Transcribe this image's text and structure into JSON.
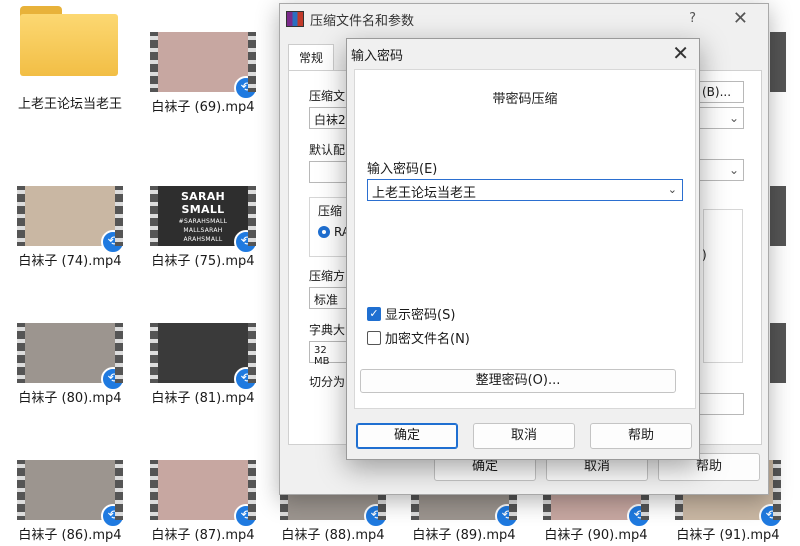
{
  "desktop": {
    "folder": {
      "name": "上老王论坛当老王"
    },
    "files": [
      {
        "name": "白袜子 (69).mp4"
      },
      {
        "name": "白袜子 (74).mp4"
      },
      {
        "name": "白袜子 (75).mp4",
        "thumb_title": "SARAH SMALL",
        "thumb_lines": [
          "#SARAHSMALL",
          "MALLSARAH",
          "ARAHSMALL"
        ]
      },
      {
        "name": "白袜子 (80).mp4"
      },
      {
        "name": "白袜子 (81).mp4"
      },
      {
        "name": "白袜子 (86).mp4"
      },
      {
        "name": "白袜子 (87).mp4"
      },
      {
        "name": "白袜子 (88).mp4"
      },
      {
        "name": "白袜子 (89).mp4"
      },
      {
        "name": "白袜子 (90).mp4"
      },
      {
        "name": "白袜子 (91).mp4"
      }
    ]
  },
  "main_dialog": {
    "title": "压缩文件名和参数",
    "help_glyph": "?",
    "tab_general": "常规",
    "archive_name_label": "压缩文",
    "archive_name_value": "白袜2",
    "browse_button": "(B)...",
    "default_profile_label": "默认配",
    "format_group_label": "压缩",
    "format_radio_label": "RA",
    "method_label": "压缩方",
    "method_value": "标准",
    "dict_label": "字典大",
    "dict_value": "32 MB",
    "split_label": "切分为",
    "right_fragment": ")",
    "ok": "确定",
    "cancel": "取消",
    "help": "帮助"
  },
  "password_dialog": {
    "title": "输入密码",
    "heading": "带密码压缩",
    "password_label": "输入密码(E)",
    "password_value": "上老王论坛当老王",
    "show_password_label": "显示密码(S)",
    "show_password_checked": true,
    "encrypt_names_label": "加密文件名(N)",
    "encrypt_names_checked": false,
    "manage_button": "整理密码(O)...",
    "ok": "确定",
    "cancel": "取消",
    "help": "帮助"
  },
  "colors": {
    "accent": "#1f6fd1",
    "badge": "#1f7ae0",
    "folder": "#f2be45"
  }
}
